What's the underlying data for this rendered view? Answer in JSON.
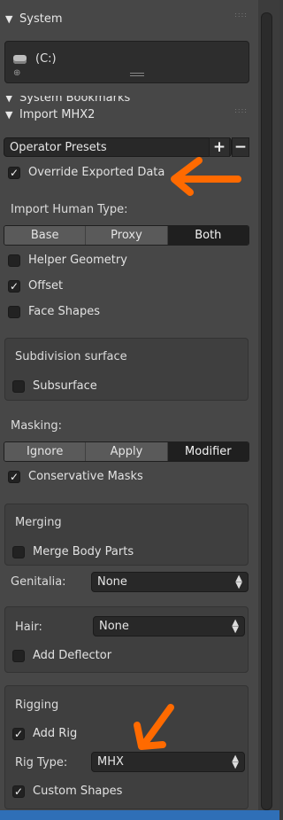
{
  "system": {
    "title": "System",
    "drive_label": "(C:)"
  },
  "bookmarks": {
    "title": "System Bookmarks"
  },
  "import": {
    "title": "Import MHX2",
    "presets_label": "Operator Presets",
    "override_label": "Override Exported Data",
    "human_type_label": "Import Human Type:",
    "human_types": [
      "Base",
      "Proxy",
      "Both"
    ],
    "human_type_selected": "Both",
    "helper_geometry": "Helper Geometry",
    "offset": "Offset",
    "face_shapes": "Face Shapes",
    "subdiv_title": "Subdivision surface",
    "subsurface": "Subsurface",
    "masking_label": "Masking:",
    "masking_options": [
      "Ignore",
      "Apply",
      "Modifier"
    ],
    "masking_selected": "Modifier",
    "conservative_masks": "Conservative Masks",
    "merging_title": "Merging",
    "merge_body_parts": "Merge Body Parts",
    "genitalia_label": "Genitalia:",
    "genitalia_value": "None",
    "hair_label": "Hair:",
    "hair_value": "None",
    "add_deflector": "Add Deflector",
    "rigging_title": "Rigging",
    "add_rig": "Add Rig",
    "rig_type_label": "Rig Type:",
    "rig_type_value": "MHX",
    "custom_shapes": "Custom Shapes"
  },
  "colors": {
    "annotation": "#ff6a00",
    "panel": "#474747",
    "field": "#282828"
  }
}
